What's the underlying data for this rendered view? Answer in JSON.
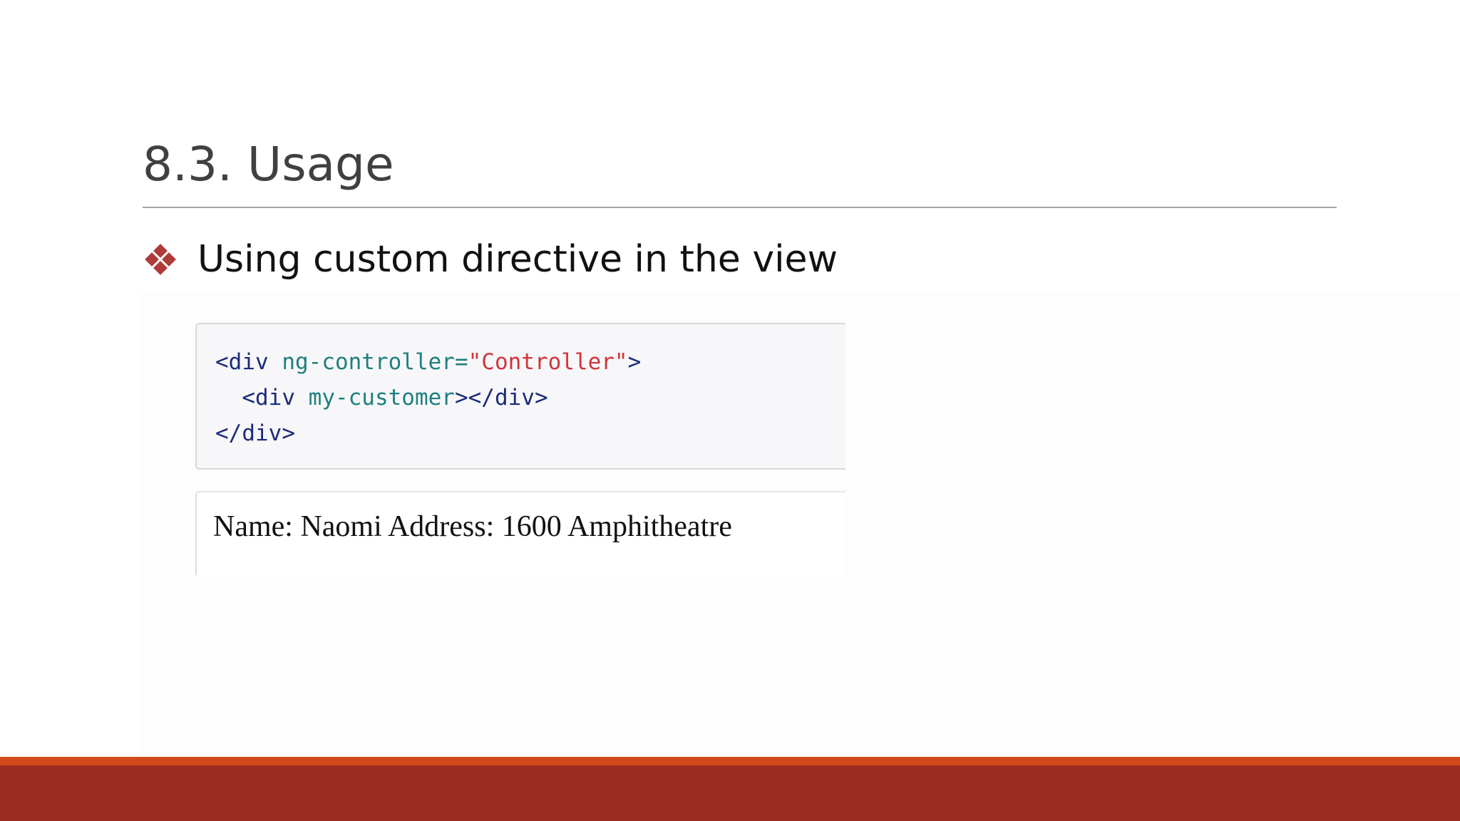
{
  "slide": {
    "title": "8.3. Usage",
    "bullet": {
      "icon": "diamond-cluster-bullet-icon",
      "text": "Using custom directive in the view"
    }
  },
  "code_example": {
    "line1": {
      "open": "<div ",
      "attr": "ng-controller=",
      "value": "\"Controller\"",
      "close": ">"
    },
    "line2": {
      "indent": "  ",
      "open": "<div ",
      "attr": "my-customer",
      "close": "></div>"
    },
    "line3": {
      "close": "</div>"
    }
  },
  "output": {
    "text": "Name: Naomi Address: 1600 Amphitheatre"
  },
  "colors": {
    "bullet": "#b03a3a",
    "footer_accent": "#d24a1c",
    "footer_bar": "#9b2d20",
    "code_tag": "#1b2b7a",
    "code_attr": "#1f7f7f",
    "code_string": "#d1333a"
  }
}
